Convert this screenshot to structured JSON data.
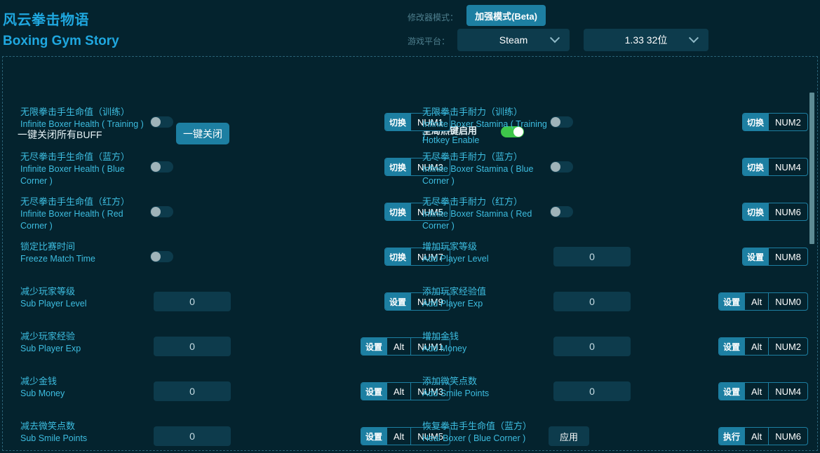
{
  "header": {
    "title_cn": "风云拳击物语",
    "title_en": "Boxing Gym Story",
    "mode_label": "修改器模式：",
    "mode_button": "加强模式(Beta)",
    "platform_label": "游戏平台：",
    "platform_value": "Steam",
    "version_value": "1.33 32位",
    "chevron_icon": "chevron-down-icon"
  },
  "topbar": {
    "onekey_label": "一键关闭所有BUFF",
    "onekey_button": "一键关闭",
    "hotkey_enable_cn": "全局热键启用",
    "hotkey_enable_en": "Hotkey Enable",
    "hotkey_enable_state": "on"
  },
  "colors": {
    "background": "#04232e",
    "accent": "#1d7fa2",
    "label_cyan": "#3dbde0",
    "title_blue": "#1fa7df",
    "field_bg": "#0d3b4c",
    "toggle_on": "#3ec64a",
    "border_dashed": "#2a6276",
    "scrollbar": "#5d8b94"
  },
  "rows_left": [
    {
      "cn": "无限拳击手生命值（训练）",
      "en": "Infinite Boxer Health ( Training )",
      "control": "toggle",
      "toggle_state": "off",
      "hotkey": {
        "action": "切换",
        "keys": [
          "NUM1"
        ]
      }
    },
    {
      "cn": "无尽拳击手生命值（蓝方）",
      "en": "Infinite Boxer Health ( Blue Corner )",
      "control": "toggle",
      "toggle_state": "off",
      "hotkey": {
        "action": "切换",
        "keys": [
          "NUM3"
        ]
      }
    },
    {
      "cn": "无尽拳击手生命值（红方）",
      "en": "Infinite Boxer Health ( Red Corner )",
      "control": "toggle",
      "toggle_state": "off",
      "hotkey": {
        "action": "切换",
        "keys": [
          "NUM5"
        ]
      }
    },
    {
      "cn": "锁定比赛时间",
      "en": "Freeze Match Time",
      "control": "toggle",
      "toggle_state": "off",
      "hotkey": {
        "action": "切换",
        "keys": [
          "NUM7"
        ]
      }
    },
    {
      "cn": "减少玩家等级",
      "en": "Sub Player Level",
      "control": "number",
      "value": "0",
      "hotkey": {
        "action": "设置",
        "keys": [
          "NUM9"
        ]
      }
    },
    {
      "cn": "减少玩家经验",
      "en": "Sub Player Exp",
      "control": "number",
      "value": "0",
      "hotkey": {
        "action": "设置",
        "keys": [
          "Alt",
          "NUM1"
        ]
      }
    },
    {
      "cn": "减少金钱",
      "en": "Sub Money",
      "control": "number",
      "value": "0",
      "hotkey": {
        "action": "设置",
        "keys": [
          "Alt",
          "NUM3"
        ]
      }
    },
    {
      "cn": "减去微笑点数",
      "en": "Sub Smile Points",
      "control": "number",
      "value": "0",
      "hotkey": {
        "action": "设置",
        "keys": [
          "Alt",
          "NUM5"
        ]
      }
    }
  ],
  "rows_right": [
    {
      "cn": "无限拳击手耐力（训练）",
      "en": "Infinite Boxer Stamina ( Training )",
      "control": "toggle",
      "toggle_state": "off",
      "hotkey": {
        "action": "切换",
        "keys": [
          "NUM2"
        ]
      }
    },
    {
      "cn": "无尽拳击手耐力（蓝方）",
      "en": "Infinite Boxer Stamina ( Blue Corner )",
      "control": "toggle",
      "toggle_state": "off",
      "hotkey": {
        "action": "切换",
        "keys": [
          "NUM4"
        ]
      }
    },
    {
      "cn": "无尽拳击手耐力（红方）",
      "en": "Infinite Boxer Stamina ( Red Corner )",
      "control": "toggle",
      "toggle_state": "off",
      "hotkey": {
        "action": "切换",
        "keys": [
          "NUM6"
        ]
      }
    },
    {
      "cn": "增加玩家等级",
      "en": "Add Player Level",
      "control": "number",
      "value": "0",
      "hotkey": {
        "action": "设置",
        "keys": [
          "NUM8"
        ]
      }
    },
    {
      "cn": "添加玩家经验值",
      "en": "Add Player Exp",
      "control": "number",
      "value": "0",
      "hotkey": {
        "action": "设置",
        "keys": [
          "Alt",
          "NUM0"
        ]
      }
    },
    {
      "cn": "增加金钱",
      "en": "Add Money",
      "control": "number",
      "value": "0",
      "hotkey": {
        "action": "设置",
        "keys": [
          "Alt",
          "NUM2"
        ]
      }
    },
    {
      "cn": "添加微笑点数",
      "en": "Add Smile Points",
      "control": "number",
      "value": "0",
      "hotkey": {
        "action": "设置",
        "keys": [
          "Alt",
          "NUM4"
        ]
      }
    },
    {
      "cn": "恢复拳击手生命值（蓝方）",
      "en": "Heal Boxer ( Blue Corner )",
      "control": "apply",
      "apply_label": "应用",
      "hotkey": {
        "action": "执行",
        "keys": [
          "Alt",
          "NUM6"
        ]
      }
    }
  ]
}
